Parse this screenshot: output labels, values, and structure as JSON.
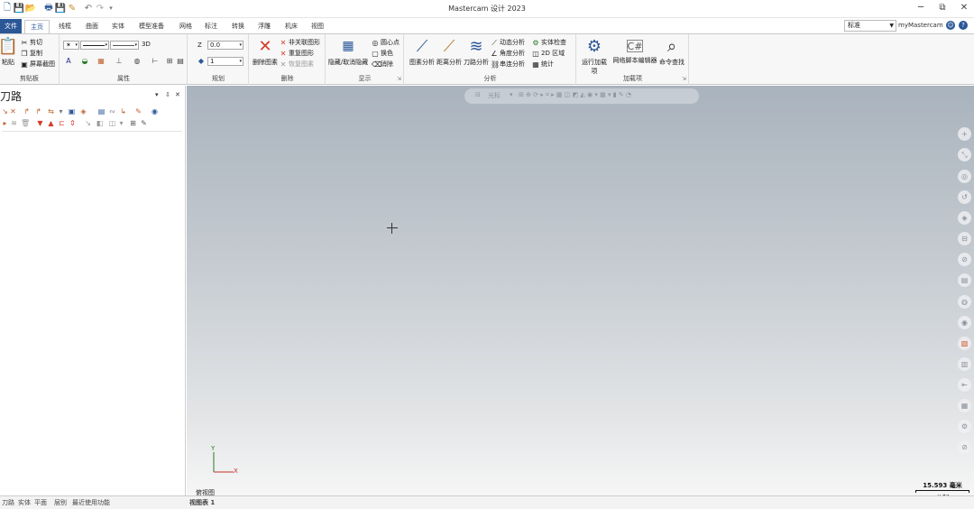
{
  "window": {
    "title": "Mastercam 设计 2023",
    "minimize": "─",
    "restore": "⧉",
    "close": "✕"
  },
  "quick_access": {
    "icons": [
      "new-file-icon",
      "save-icon",
      "open-icon",
      "print-icon",
      "save-as-icon",
      "format-painter-icon",
      "undo-icon",
      "redo-icon",
      "customize-icon"
    ]
  },
  "tabs": [
    "文件",
    "主页",
    "线框",
    "曲面",
    "实体",
    "模型准备",
    "网格",
    "标注",
    "转换",
    "浮雕",
    "机床",
    "视图"
  ],
  "workspace": {
    "value": "标准"
  },
  "account": {
    "label": "myMastercam"
  },
  "ribbon": {
    "clipboard": {
      "label": "剪贴板",
      "paste": "粘贴",
      "cut": "剪切",
      "copy": "复制",
      "copy_screen": "屏幕截图"
    },
    "attributes": {
      "label": "属性",
      "threed": "3D"
    },
    "plane": {
      "label": "规划",
      "z_label": "Z",
      "z_value": "0.0",
      "level_value": "1"
    },
    "delete": {
      "label": "删除",
      "delete_entity": "删除图素",
      "unrelated": "非关联图形",
      "restore": "重复图形",
      "undelete": "恢复图素"
    },
    "display": {
      "label": "显示",
      "hide_show": "隐藏/取消隐藏",
      "center_point": "圆心点",
      "hide_other": "换色",
      "clear": "消除"
    },
    "analyze": {
      "label": "分析",
      "entity": "图素分析",
      "distance": "距离分析",
      "toolpath": "刀路分析",
      "dynamic": "动态分析",
      "angle": "角度分析",
      "chain": "串连分析",
      "solid_check": "实体检查",
      "area_2d": "2D 区域",
      "statistics": "统计"
    },
    "addins": {
      "label": "加载项",
      "run": "运行加载项",
      "net_editor": "网络脚本编辑器",
      "find": "命令查找"
    }
  },
  "left_panel": {
    "title": "刀路",
    "pin": "▾ ⇩ ✕"
  },
  "viewport": {
    "toolbar_text": "光标",
    "view_name": "俯视图",
    "scale_value": "15.593 毫米",
    "scale_units": "公制",
    "axis_x": "X",
    "axis_y": "Y"
  },
  "status_bar": {
    "items": [
      "刀路",
      "实体",
      "平面",
      "层别",
      "最近使用功能"
    ],
    "viewsheet": "视图表 1"
  }
}
